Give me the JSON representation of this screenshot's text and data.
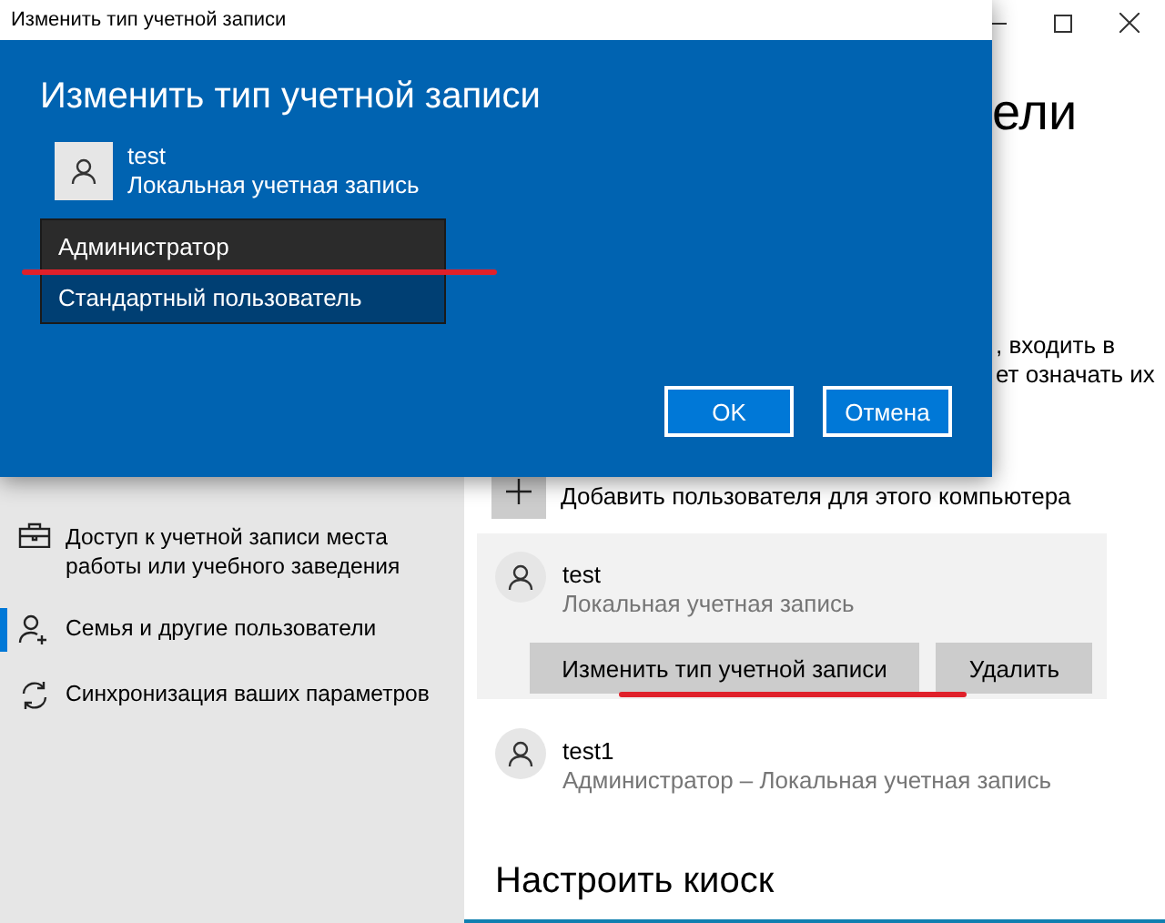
{
  "settings_window": {
    "heading_fragment": "ели",
    "intro_fragments": [
      ", входить в",
      "ет означать их"
    ]
  },
  "sidebar": {
    "items": [
      {
        "kind": "work",
        "label": "Доступ к учетной записи места работы или учебного заведения",
        "selected": false
      },
      {
        "kind": "family",
        "label": "Семья и другие пользователи",
        "selected": true
      },
      {
        "kind": "sync",
        "label": "Синхронизация ваших параметров",
        "selected": false
      }
    ]
  },
  "add_user": {
    "label": "Добавить пользователя для этого компьютера"
  },
  "users": [
    {
      "name": "test",
      "subtitle": "Локальная учетная запись",
      "expanded": true,
      "buttons": [
        "Изменить тип учетной записи",
        "Удалить"
      ]
    },
    {
      "name": "test1",
      "subtitle": "Администратор – Локальная учетная запись",
      "expanded": false
    }
  ],
  "kiosk_heading": "Настроить киоск",
  "dialog": {
    "window_title": "Изменить тип учетной записи",
    "heading": "Изменить тип учетной записи",
    "account": {
      "name": "test",
      "subtitle": "Локальная учетная запись"
    },
    "account_types": [
      {
        "label": "Администратор",
        "selected": false,
        "hovered": true
      },
      {
        "label": "Стандартный пользователь",
        "selected": true,
        "hovered": false
      }
    ],
    "buttons": [
      "OK",
      "Отмена"
    ]
  }
}
